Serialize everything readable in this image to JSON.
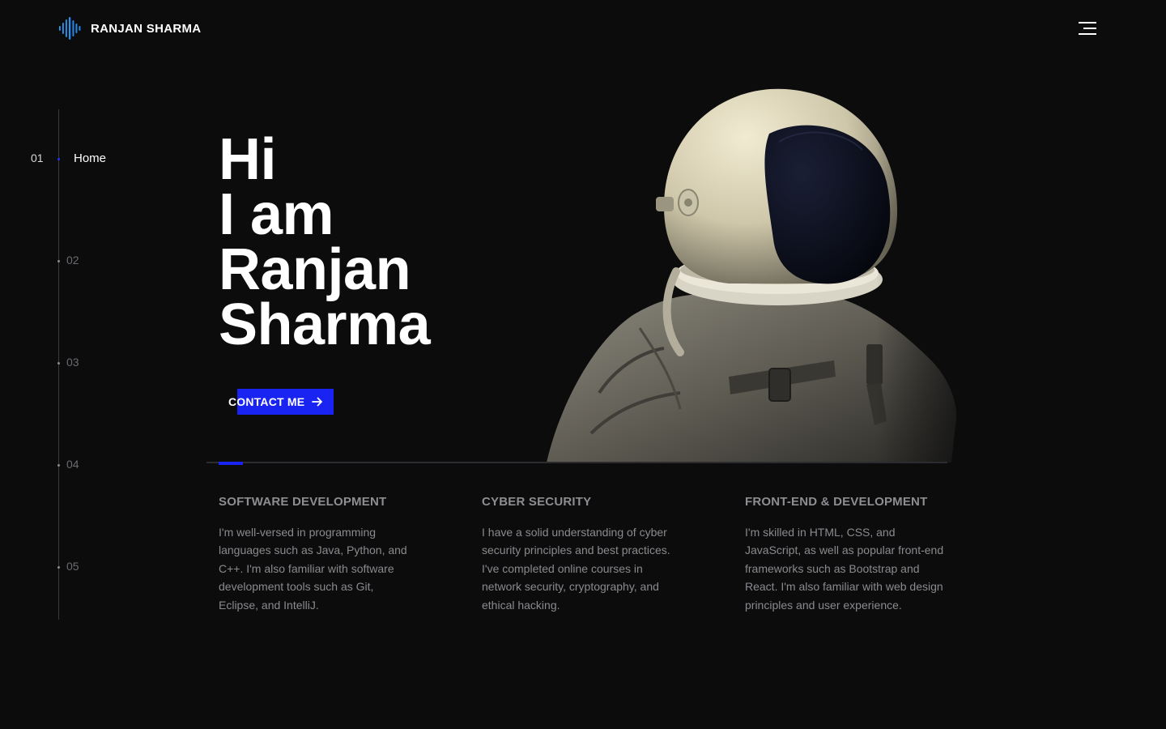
{
  "header": {
    "brand": "RANJAN SHARMA",
    "logo_icon": "audio-wave-logo-icon",
    "menu_icon": "hamburger-menu-icon"
  },
  "side_nav": {
    "items": [
      {
        "number": "01",
        "label": "Home",
        "active": true
      },
      {
        "number": "02",
        "label": "",
        "active": false
      },
      {
        "number": "03",
        "label": "",
        "active": false
      },
      {
        "number": "04",
        "label": "",
        "active": false
      },
      {
        "number": "05",
        "label": "",
        "active": false
      }
    ]
  },
  "hero": {
    "line1": "Hi",
    "line2": "I am",
    "line3": "Ranjan",
    "line4": "Sharma",
    "cta_label": "CONTACT ME",
    "cta_icon": "arrow-right-icon"
  },
  "services": [
    {
      "title": "SOFTWARE DEVELOPMENT",
      "text": "I'm well-versed in programming languages such as Java, Python, and C++. I'm also familiar with software development tools such as Git, Eclipse, and IntelliJ."
    },
    {
      "title": "CYBER SECURITY",
      "text": "I have a solid understanding of cyber security principles and best practices. I've completed online courses in network security, cryptography, and ethical hacking."
    },
    {
      "title": "FRONT-END & DEVELOPMENT",
      "text": "I'm skilled in HTML, CSS, and JavaScript, as well as popular front-end frameworks such as Bootstrap and React. I'm also familiar with web design principles and user experience."
    }
  ],
  "colors": {
    "background": "#0c0c0d",
    "accent": "#1a24f2",
    "logo_gradient_start": "#1db8d8",
    "logo_gradient_end": "#2a5cf0"
  }
}
